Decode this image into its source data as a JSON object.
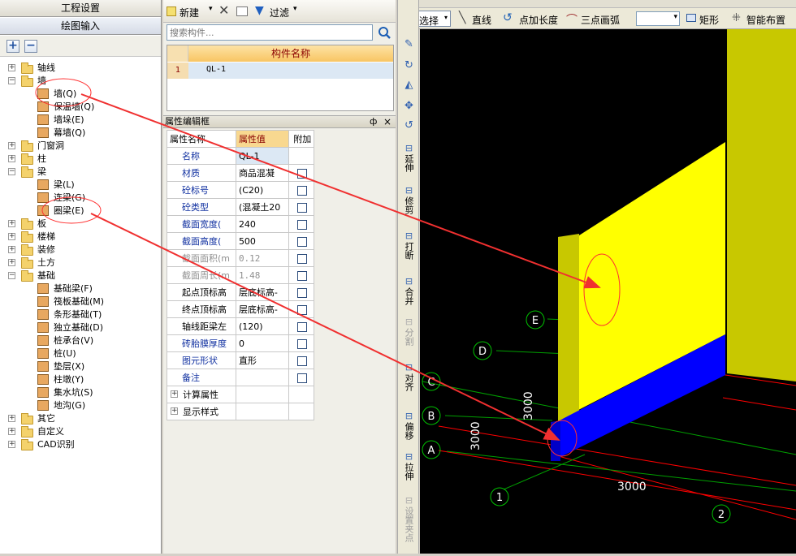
{
  "left_panel": {
    "header1": "工程设置",
    "header2": "绘图输入",
    "add_symbol": "+",
    "remove_symbol": "−",
    "tree": [
      {
        "label": "轴线",
        "level": 0,
        "state": "+",
        "type": "folder"
      },
      {
        "label": "墙",
        "level": 0,
        "state": "−",
        "type": "folder"
      },
      {
        "label": "墙(Q)",
        "level": 1,
        "type": "item"
      },
      {
        "label": "保温墙(Q)",
        "level": 1,
        "type": "item"
      },
      {
        "label": "墙垛(E)",
        "level": 1,
        "type": "item"
      },
      {
        "label": "幕墙(Q)",
        "level": 1,
        "type": "item"
      },
      {
        "label": "门窗洞",
        "level": 0,
        "state": "+",
        "type": "folder"
      },
      {
        "label": "柱",
        "level": 0,
        "state": "+",
        "type": "folder"
      },
      {
        "label": "梁",
        "level": 0,
        "state": "−",
        "type": "folder"
      },
      {
        "label": "梁(L)",
        "level": 1,
        "type": "item"
      },
      {
        "label": "连梁(G)",
        "level": 1,
        "type": "item"
      },
      {
        "label": "圈梁(E)",
        "level": 1,
        "type": "item"
      },
      {
        "label": "板",
        "level": 0,
        "state": "+",
        "type": "folder"
      },
      {
        "label": "楼梯",
        "level": 0,
        "state": "+",
        "type": "folder"
      },
      {
        "label": "装修",
        "level": 0,
        "state": "+",
        "type": "folder"
      },
      {
        "label": "土方",
        "level": 0,
        "state": "+",
        "type": "folder"
      },
      {
        "label": "基础",
        "level": 0,
        "state": "−",
        "type": "folder"
      },
      {
        "label": "基础梁(F)",
        "level": 1,
        "type": "item"
      },
      {
        "label": "筏板基础(M)",
        "level": 1,
        "type": "item"
      },
      {
        "label": "条形基础(T)",
        "level": 1,
        "type": "item"
      },
      {
        "label": "独立基础(D)",
        "level": 1,
        "type": "item"
      },
      {
        "label": "桩承台(V)",
        "level": 1,
        "type": "item"
      },
      {
        "label": "桩(U)",
        "level": 1,
        "type": "item"
      },
      {
        "label": "垫层(X)",
        "level": 1,
        "type": "item"
      },
      {
        "label": "柱墩(Y)",
        "level": 1,
        "type": "item"
      },
      {
        "label": "集水坑(S)",
        "level": 1,
        "type": "item"
      },
      {
        "label": "地沟(G)",
        "level": 1,
        "type": "item"
      },
      {
        "label": "其它",
        "level": 0,
        "state": "+",
        "type": "folder"
      },
      {
        "label": "自定义",
        "level": 0,
        "state": "+",
        "type": "folder"
      },
      {
        "label": "CAD识别",
        "level": 0,
        "state": "+",
        "type": "folder"
      }
    ]
  },
  "component_list": {
    "toolbar": {
      "new_label": "新建",
      "filter_label": "过滤"
    },
    "search_placeholder": "搜索构件...",
    "column_header": "构件名称",
    "rows": [
      {
        "index": "1",
        "name": "QL-1"
      }
    ]
  },
  "property_editor": {
    "title": "属性编辑框",
    "pin_symbol": "ф",
    "close_symbol": "×",
    "headers": {
      "name": "属性名称",
      "value": "属性值",
      "extra": "附加"
    },
    "rows": [
      {
        "name": "名称",
        "value": "QL-1",
        "style": "blue",
        "check": false
      },
      {
        "name": "材质",
        "value": "商品混凝",
        "style": "blue",
        "check": true
      },
      {
        "name": "砼标号",
        "value": "(C20)",
        "style": "blue",
        "check": true
      },
      {
        "name": "砼类型",
        "value": "(混凝土20",
        "style": "blue",
        "check": true
      },
      {
        "name": "截面宽度(",
        "value": "240",
        "style": "blue",
        "check": true
      },
      {
        "name": "截面高度(",
        "value": "500",
        "style": "blue",
        "check": true
      },
      {
        "name": "截面面积(m",
        "value": "0.12",
        "style": "gray",
        "check": true
      },
      {
        "name": "截面周长(m",
        "value": "1.48",
        "style": "gray",
        "check": true
      },
      {
        "name": "起点顶标高",
        "value": "层底标高-",
        "style": "black",
        "check": true
      },
      {
        "name": "终点顶标高",
        "value": "层底标高-",
        "style": "black",
        "check": true
      },
      {
        "name": "轴线距梁左",
        "value": "(120)",
        "style": "black",
        "check": true
      },
      {
        "name": "砖胎膜厚度",
        "value": "0",
        "style": "blue",
        "check": true
      },
      {
        "name": "图元形状",
        "value": "直形",
        "style": "blue",
        "check": true
      },
      {
        "name": "备注",
        "value": "",
        "style": "blue",
        "check": true
      }
    ],
    "groups": [
      {
        "label": "计算属性"
      },
      {
        "label": "显示样式"
      }
    ]
  },
  "draw_toolbar": {
    "select_label": "选择",
    "line_label": "直线",
    "point_length_label": "点加长度",
    "arc_label": "三点画弧",
    "rect_label": "矩形",
    "smart_label": "智能布置"
  },
  "vertical_toolbar": [
    {
      "label": "延伸"
    },
    {
      "label": "修剪"
    },
    {
      "label": "打断"
    },
    {
      "label": "合并"
    },
    {
      "label": "分割"
    },
    {
      "label": "对齐"
    },
    {
      "label": "偏移"
    },
    {
      "label": "拉伸"
    },
    {
      "label": "设置夹点"
    }
  ],
  "viewport": {
    "axis_labels": [
      "E",
      "D",
      "C",
      "B",
      "A",
      "1",
      "2"
    ],
    "dims": {
      "vertical_left": "3000",
      "vertical_right": "3000",
      "horizontal": "3000"
    },
    "colors": {
      "wall": "#ffff00",
      "wall_side": "#c8c800",
      "beam": "#0000ff",
      "annotation": "#ff3030",
      "axis": "#00c000",
      "grid_red": "#ff0000"
    }
  }
}
